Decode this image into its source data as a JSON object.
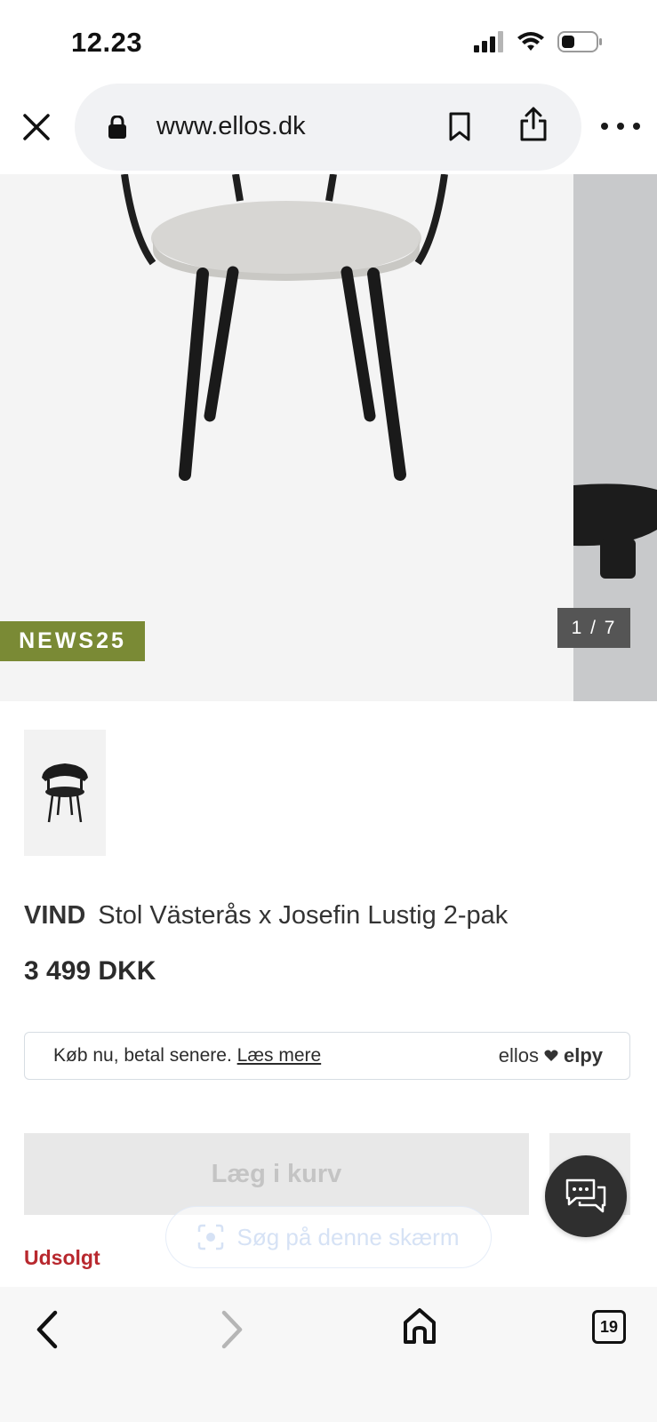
{
  "status_bar": {
    "time": "12.23"
  },
  "browser": {
    "url": "www.ellos.dk"
  },
  "gallery": {
    "promo_badge": "NEWS25",
    "counter": "1 / 7"
  },
  "product": {
    "brand": "VIND",
    "name": "Stol Västerås x Josefin Lustig 2-pak",
    "price": "3 499 DKK"
  },
  "financing": {
    "text": "Køb nu, betal senere.",
    "link": "Læs mere",
    "logo_left": "ellos",
    "logo_right": "elpy"
  },
  "actions": {
    "add_to_cart": "Læg i kurv"
  },
  "screen_search": {
    "label": "Søg på denne skærm"
  },
  "stock_status": "Udsolgt",
  "bottom_nav": {
    "tab_count": "19"
  },
  "colors": {
    "promo": "#7a8a35",
    "soldout": "#b8282e",
    "chat": "#2f2f2f"
  }
}
